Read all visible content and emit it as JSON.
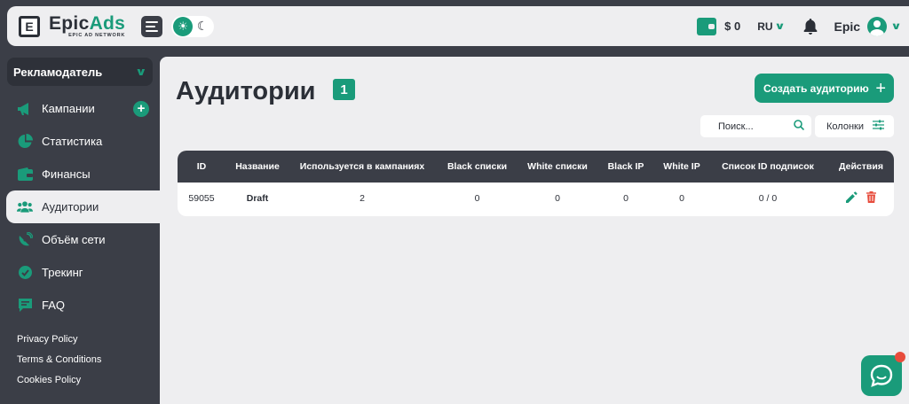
{
  "header": {
    "logo_mark": "E",
    "logo_name_1": "Epic",
    "logo_name_2": "Ads",
    "logo_sub": "EPIC AD NETWORK",
    "balance": "$ 0",
    "language": "RU",
    "user_name": "Epic"
  },
  "sidebar": {
    "role": "Рекламодатель",
    "items": [
      {
        "label": "Кампании",
        "icon": "megaphone-icon"
      },
      {
        "label": "Статистика",
        "icon": "chart-icon"
      },
      {
        "label": "Финансы",
        "icon": "wallet-icon"
      },
      {
        "label": "Аудитории",
        "icon": "users-icon"
      },
      {
        "label": "Объём сети",
        "icon": "satellite-icon"
      },
      {
        "label": "Трекинг",
        "icon": "tracking-icon"
      },
      {
        "label": "FAQ",
        "icon": "faq-icon"
      }
    ],
    "footer": [
      "Privacy Policy",
      "Terms & Conditions",
      "Cookies Policy"
    ]
  },
  "main": {
    "title": "Аудитории",
    "count": "1",
    "create_button": "Создать аудиторию",
    "search_placeholder": "Поиск...",
    "columns_button": "Колонки",
    "table": {
      "headers": [
        "ID",
        "Название",
        "Используется в кампаниях",
        "Black списки",
        "White списки",
        "Black IP",
        "White IP",
        "Список ID подписок",
        "Действия"
      ],
      "rows": [
        {
          "id": "59055",
          "name": "Draft",
          "used_in": "2",
          "black_lists": "0",
          "white_lists": "0",
          "black_ip": "0",
          "white_ip": "0",
          "sub_ids": "0 / 0"
        }
      ]
    }
  },
  "colors": {
    "accent": "#1a9b7a",
    "dark": "#3b3e47",
    "danger": "#e74c3c"
  }
}
